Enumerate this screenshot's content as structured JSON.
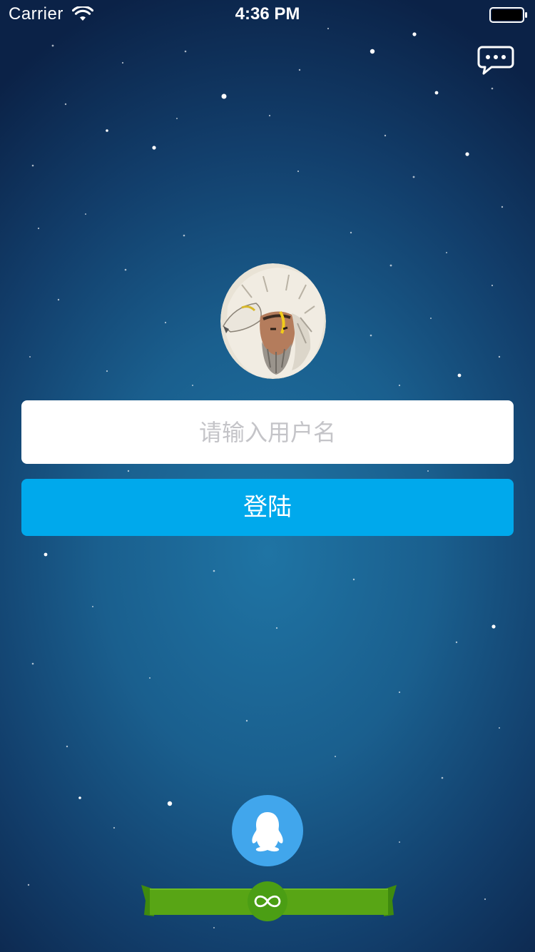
{
  "status_bar": {
    "carrier": "Carrier",
    "time": "4:36 PM"
  },
  "login": {
    "username_placeholder": "请输入用户名",
    "username_value": "",
    "login_label": "登陆"
  },
  "icons": {
    "wifi": "wifi-icon",
    "battery": "battery-icon",
    "chat": "chat-bubble-icon",
    "avatar": "wolf-hero-avatar",
    "qq": "qq-penguin-icon",
    "ribbon_badge": "infinity-icon"
  },
  "colors": {
    "background_top": "#0b2247",
    "background_center": "#1f74a4",
    "login_button": "#00a9ec",
    "qq_button": "#41a6ec",
    "ribbon": "#4b9e14",
    "placeholder_text": "#c4c4c8"
  }
}
